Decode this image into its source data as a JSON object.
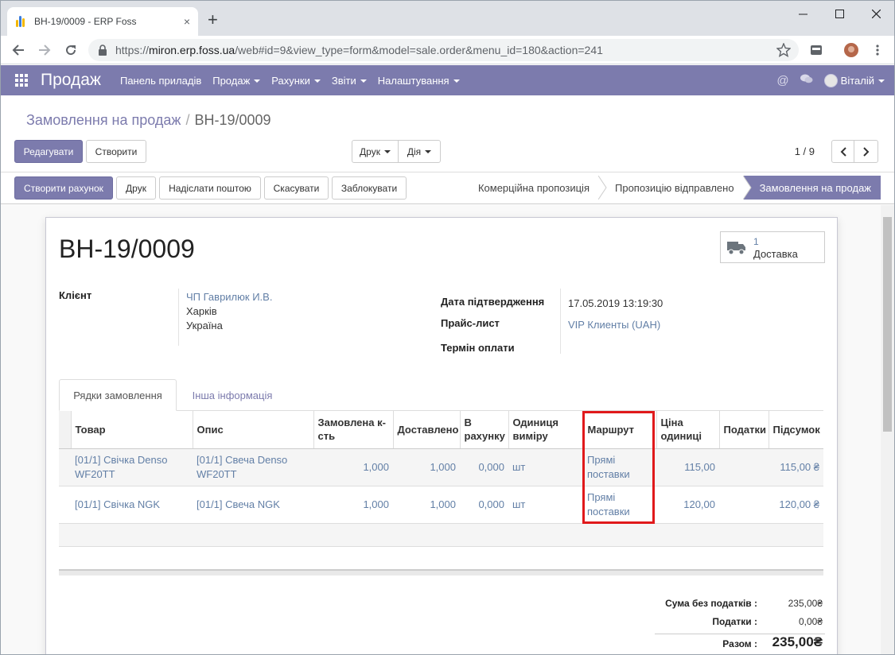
{
  "browser": {
    "tab_title": "ВН-19/0009 - ERP Foss",
    "tab_close": "×",
    "new_tab": "+",
    "url_prefix": "https://",
    "url_host": "miron.erp.foss.ua",
    "url_path": "/web#id=9&view_type=form&model=sale.order&menu_id=180&action=241"
  },
  "navbar": {
    "brand": "Продаж",
    "menus": [
      "Панель приладів",
      "Продаж",
      "Рахунки",
      "Звіти",
      "Налаштування"
    ],
    "user": "Віталій",
    "color": "#7c7bad"
  },
  "control_panel": {
    "breadcrumb_parent": "Замовлення на продаж",
    "breadcrumb_sep": "/",
    "breadcrumb_current": "ВН-19/0009",
    "edit_label": "Редагувати",
    "create_label": "Створити",
    "print_label": "Друк",
    "action_label": "Дія",
    "pager": "1 / 9"
  },
  "statusbar": {
    "buttons": [
      "Створити рахунок",
      "Друк",
      "Надіслати поштою",
      "Скасувати",
      "Заблокувати"
    ],
    "stages": [
      "Комерційна пропозиція",
      "Пропозицію відправлено",
      "Замовлення на продаж"
    ],
    "active_stage": "Замовлення на продаж"
  },
  "form": {
    "name": "ВН-19/0009",
    "delivery_count": "1",
    "delivery_label": "Доставка",
    "client_label": "Клієнт",
    "client_name": "ЧП Гаврилюк И.В.",
    "client_city": "Харків",
    "client_country": "Україна",
    "confirm_date_label": "Дата підтвердження",
    "confirm_date": "17.05.2019 13:19:30",
    "pricelist_label": "Прайс-лист",
    "pricelist": "VIP Клиенты (UAH)",
    "payment_term_label": "Термін оплати",
    "tabs": [
      "Рядки замовлення",
      "Інша інформація"
    ]
  },
  "lines": {
    "headers": [
      "Товар",
      "Опис",
      "Замовлена к-сть",
      "Доставлено",
      "В рахунку",
      "Одиниця виміру",
      "Маршрут",
      "Ціна одиниці",
      "Податки",
      "Підсумок"
    ],
    "rows": [
      {
        "product": "[01/1] Свічка Denso WF20TT",
        "desc": "[01/1] Свеча Denso WF20TT",
        "qty": "1,000",
        "delivered": "1,000",
        "invoiced": "0,000",
        "uom": "шт",
        "route": "Прямі поставки",
        "price": "115,00",
        "taxes": "",
        "subtotal": "115,00 ₴"
      },
      {
        "product": "[01/1] Свічка NGK",
        "desc": "[01/1] Свеча NGK",
        "qty": "1,000",
        "delivered": "1,000",
        "invoiced": "0,000",
        "uom": "шт",
        "route": "Прямі поставки",
        "price": "120,00",
        "taxes": "",
        "subtotal": "120,00 ₴"
      }
    ]
  },
  "totals": {
    "untaxed_label": "Сума без податків :",
    "untaxed": "235,00₴",
    "taxes_label": "Податки :",
    "taxes": "0,00₴",
    "total_label": "Разом :",
    "total": "235,00₴"
  }
}
